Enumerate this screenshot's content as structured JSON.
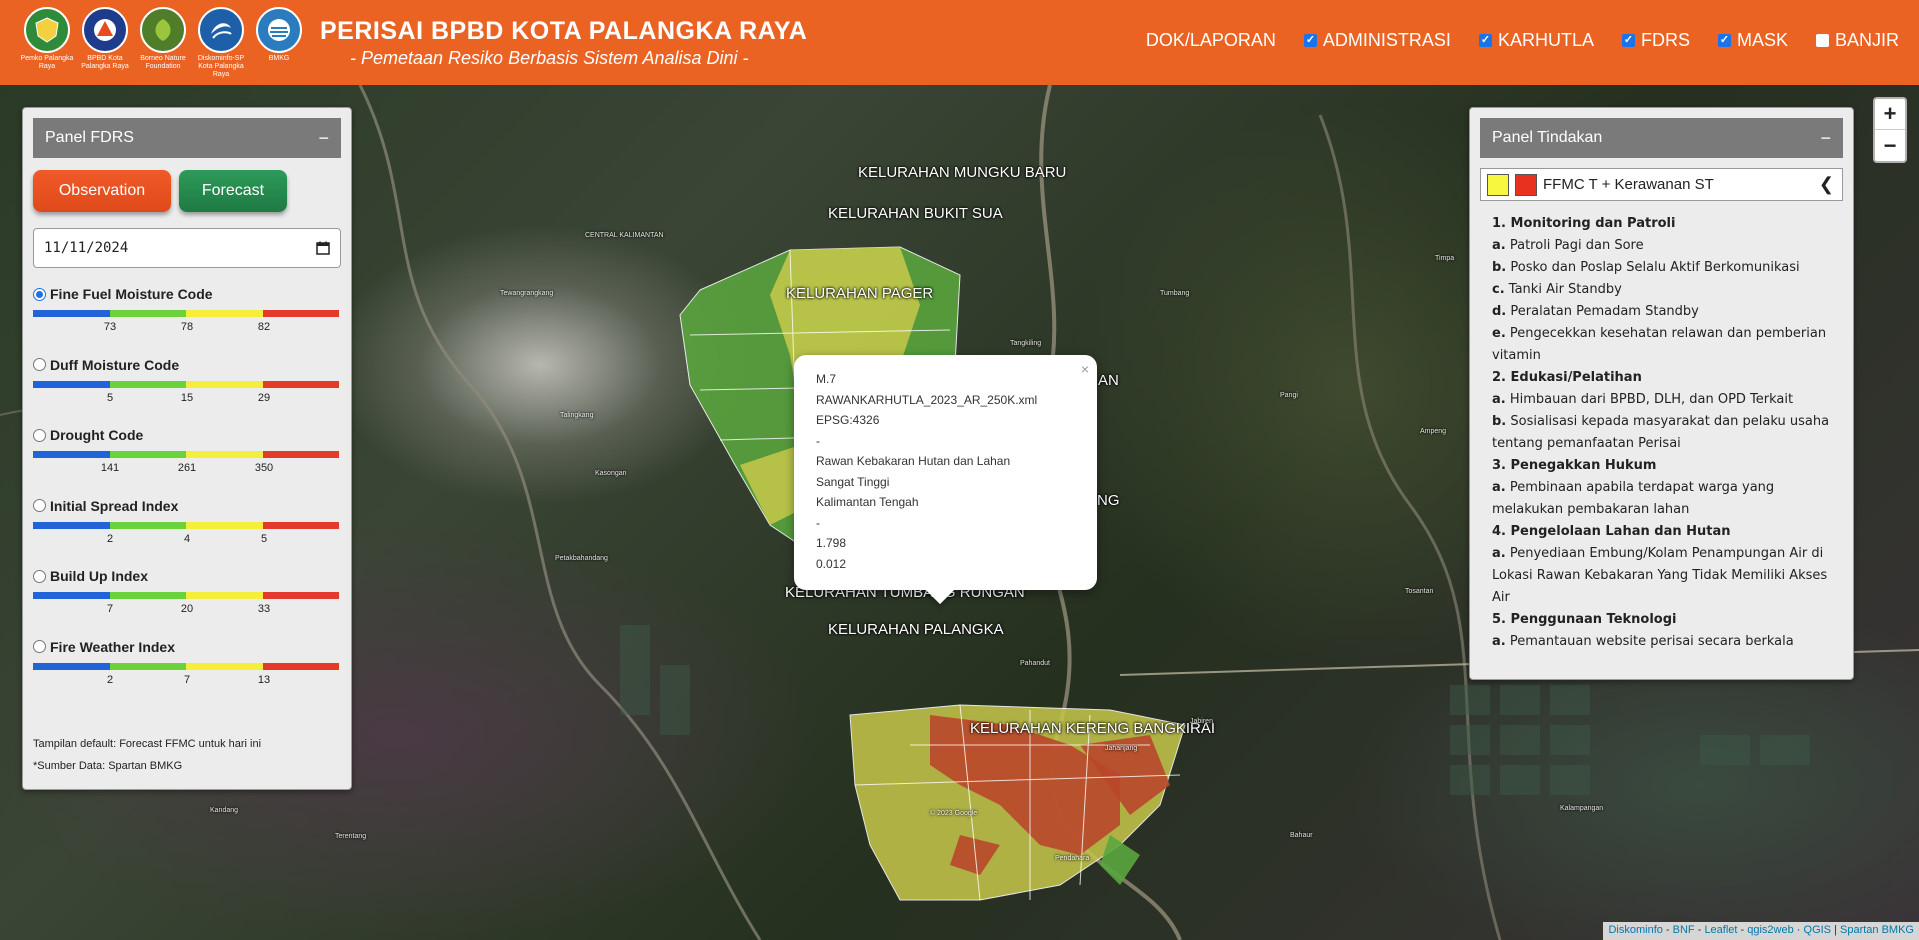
{
  "header": {
    "title": "PERISAI BPBD KOTA PALANGKA RAYA",
    "subtitle": "- Pemetaan Resiko Berbasis Sistem Analisa Dini -",
    "logos": [
      {
        "caption": "Pemko Palangka Raya",
        "color": "#2e8b3a",
        "icon": "shield-emblem"
      },
      {
        "caption": "BPBD Kota Palangka Raya",
        "color": "#1e3c8c",
        "icon": "bpbd-emblem"
      },
      {
        "caption": "Borneo Nature Foundation",
        "color": "#4f7d2a",
        "icon": "leaf-emblem"
      },
      {
        "caption": "Diskominfo-SP Kota Palangka Raya",
        "color": "#1d5fa8",
        "icon": "swirl-emblem"
      },
      {
        "caption": "BMKG",
        "color": "#2b7bbf",
        "icon": "bmkg-emblem"
      }
    ],
    "nav": [
      {
        "label": "DOK/LAPORAN",
        "checkbox": false,
        "checked": false
      },
      {
        "label": "ADMINISTRASI",
        "checkbox": true,
        "checked": true
      },
      {
        "label": "KARHUTLA",
        "checkbox": true,
        "checked": true
      },
      {
        "label": "FDRS",
        "checkbox": true,
        "checked": true
      },
      {
        "label": "MASK",
        "checkbox": true,
        "checked": true
      },
      {
        "label": "BANJIR",
        "checkbox": true,
        "checked": false
      }
    ]
  },
  "fdrs_panel": {
    "title": "Panel FDRS",
    "collapse": "−",
    "observation_label": "Observation",
    "forecast_label": "Forecast",
    "date_value": "11/11/2024",
    "scale_colors": [
      "#2264d8",
      "#6bd23c",
      "#f5ee3a",
      "#e33a2c"
    ],
    "indices": [
      {
        "label": "Fine Fuel Moisture Code",
        "selected": true,
        "ticks": [
          "73",
          "78",
          "82"
        ]
      },
      {
        "label": "Duff Moisture Code",
        "selected": false,
        "ticks": [
          "5",
          "15",
          "29"
        ]
      },
      {
        "label": "Drought Code",
        "selected": false,
        "ticks": [
          "141",
          "261",
          "350"
        ]
      },
      {
        "label": "Initial Spread Index",
        "selected": false,
        "ticks": [
          "2",
          "4",
          "5"
        ]
      },
      {
        "label": "Build Up Index",
        "selected": false,
        "ticks": [
          "7",
          "20",
          "33"
        ]
      },
      {
        "label": "Fire Weather Index",
        "selected": false,
        "ticks": [
          "2",
          "7",
          "13"
        ]
      }
    ],
    "note_default": "Tampilan default: Forecast FFMC untuk hari ini",
    "note_source": "*Sumber Data: Spartan BMKG"
  },
  "tindakan_panel": {
    "title": "Panel Tindakan",
    "collapse": "−",
    "legend_label": "FFMC T + Kerawanan ST",
    "legend_colors": [
      "#f7f740",
      "#e8321e"
    ],
    "lines": [
      {
        "type": "h",
        "text": "1. Monitoring dan Patroli"
      },
      {
        "type": "i",
        "prefix": "a.",
        "text": "Patroli Pagi dan Sore"
      },
      {
        "type": "i",
        "prefix": "b.",
        "text": "Posko dan Poslap Selalu Aktif Berkomunikasi"
      },
      {
        "type": "i",
        "prefix": "c.",
        "text": "Tanki Air Standby"
      },
      {
        "type": "i",
        "prefix": "d.",
        "text": "Peralatan Pemadam Standby"
      },
      {
        "type": "i",
        "prefix": "e.",
        "text": "Pengecekkan kesehatan relawan dan pemberian vitamin"
      },
      {
        "type": "h",
        "text": "2. Edukasi/Pelatihan"
      },
      {
        "type": "i",
        "prefix": "a.",
        "text": "Himbauan dari BPBD, DLH, dan OPD Terkait"
      },
      {
        "type": "i",
        "prefix": "b.",
        "text": "Sosialisasi kepada masyarakat dan pelaku usaha tentang pemanfaatan Perisai"
      },
      {
        "type": "h",
        "text": "3. Penegakkan Hukum"
      },
      {
        "type": "i",
        "prefix": "a.",
        "text": "Pembinaan apabila terdapat warga yang melakukan pembakaran lahan"
      },
      {
        "type": "h",
        "text": "4. Pengelolaan Lahan dan Hutan"
      },
      {
        "type": "i",
        "prefix": "a.",
        "text": "Penyediaan Embung/Kolam Penampungan Air di Lokasi Rawan Kebakaran Yang Tidak Memiliki Akses Air"
      },
      {
        "type": "h",
        "text": "5. Penggunaan Teknologi"
      },
      {
        "type": "i",
        "prefix": "a.",
        "text": "Pemantauan website perisai secara berkala"
      }
    ]
  },
  "popup": {
    "close": "×",
    "lines": [
      "M.7",
      "RAWANKARHUTLA_2023_AR_250K.xml",
      "EPSG:4326",
      "-",
      "Rawan Kebakaran Hutan dan Lahan",
      "Sangat Tinggi",
      "Kalimantan Tengah",
      "-",
      "1.798",
      "0.012"
    ]
  },
  "map_labels": [
    "KELURAHAN MUNGKU BARU",
    "KELURAHAN BUKIT SUA",
    "KELURAHAN PAGER",
    "AN",
    "NG",
    "KELURAHAN TUMBANG RUNGAN",
    "KELURAHAN PALANGKA",
    "KELURAHAN KERENG BANGKIRAI"
  ],
  "map_small_labels": [
    "CENTRAL KALIMANTAN",
    "Tewangrangkang",
    "Kasongan",
    "Petakbahandang",
    "Talingkang",
    "Pendahara",
    "Tumbang",
    "Jahanjang",
    "Timpa",
    "Ampeng",
    "Pahandut",
    "Kandang",
    "Terentang",
    "Bahaur",
    "Kalampangan",
    "Tosantan",
    "Pangi",
    "Jabiren",
    "Tangkiling",
    "© 2023 Google"
  ],
  "zoom": {
    "in": "+",
    "out": "−"
  },
  "attribution": [
    "Diskominfo",
    "BNF",
    "Leaflet",
    "qgis2web",
    "QGIS",
    "Spartan BMKG"
  ]
}
